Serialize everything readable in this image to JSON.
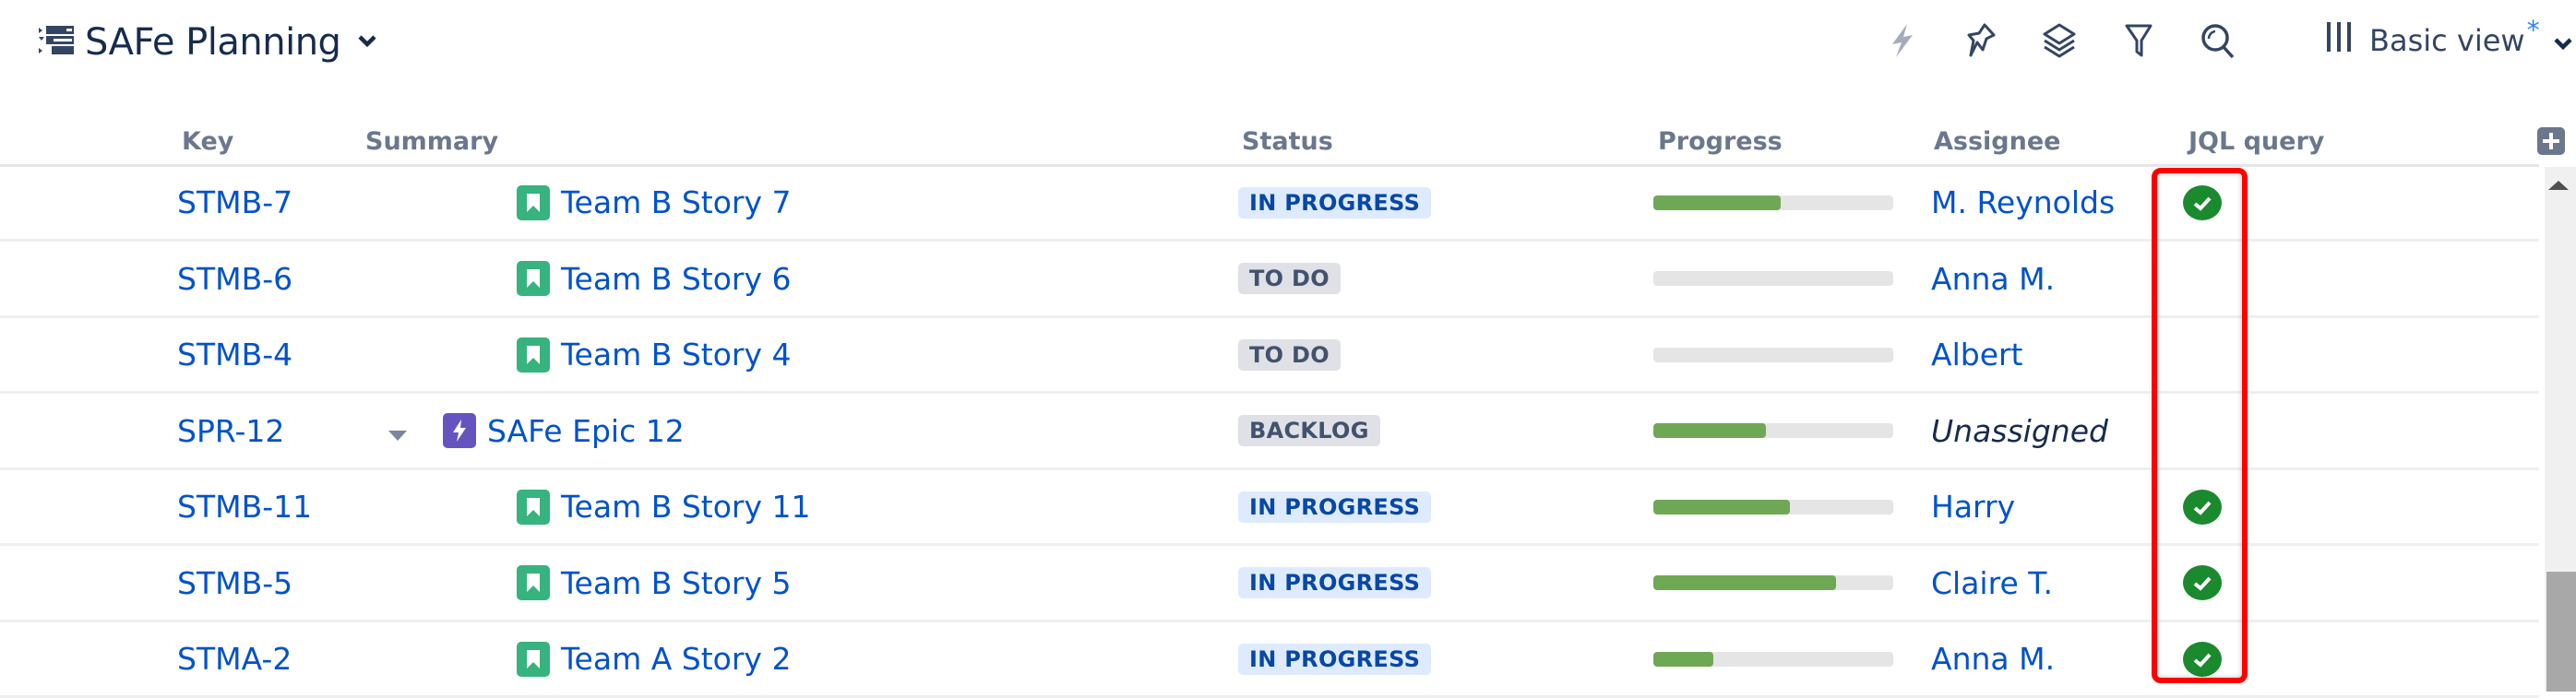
{
  "header": {
    "title": "SAFe Planning",
    "structure_icon": "structure-list-icon",
    "title_menu_icon": "chevron-down-icon",
    "toolbar_icons": [
      "lightning-icon",
      "pin-icon",
      "layers-icon",
      "filter-icon",
      "search-icon"
    ],
    "view": {
      "label": "Basic view",
      "modified_marker": "*",
      "icon": "columns-icon"
    }
  },
  "columns": {
    "key": "Key",
    "summary": "Summary",
    "status": "Status",
    "progress": "Progress",
    "assignee": "Assignee",
    "jql": "JQL query"
  },
  "rows": [
    {
      "key": "STMB-7",
      "summary": "Team B Story 7",
      "type": "story",
      "status": "IN PROGRESS",
      "status_kind": "inprogress",
      "progress_pct": 53,
      "assignee": "M. Reynolds",
      "jql_match": true
    },
    {
      "key": "STMB-6",
      "summary": "Team B Story 6",
      "type": "story",
      "status": "TO DO",
      "status_kind": "todo",
      "progress_pct": 0,
      "assignee": "Anna M.",
      "jql_match": false
    },
    {
      "key": "STMB-4",
      "summary": "Team B Story 4",
      "type": "story",
      "status": "TO DO",
      "status_kind": "todo",
      "progress_pct": 0,
      "assignee": "Albert",
      "jql_match": false
    },
    {
      "key": "SPR-12",
      "summary": "SAFe Epic 12",
      "type": "epic",
      "expanded": true,
      "status": "BACKLOG",
      "status_kind": "backlog",
      "progress_pct": 47,
      "assignee": "Unassigned",
      "unassigned": true,
      "jql_match": false
    },
    {
      "key": "STMB-11",
      "summary": "Team B Story 11",
      "type": "story",
      "status": "IN PROGRESS",
      "status_kind": "inprogress",
      "progress_pct": 57,
      "assignee": "Harry",
      "jql_match": true
    },
    {
      "key": "STMB-5",
      "summary": "Team B Story 5",
      "type": "story",
      "status": "IN PROGRESS",
      "status_kind": "inprogress",
      "progress_pct": 76,
      "assignee": "Claire T.",
      "jql_match": true
    },
    {
      "key": "STMA-2",
      "summary": "Team A Story 2",
      "type": "story",
      "status": "IN PROGRESS",
      "status_kind": "inprogress",
      "progress_pct": 25,
      "assignee": "Anna M.",
      "jql_match": true
    }
  ],
  "colors": {
    "link": "#0052cc",
    "progress_fill": "#6fa855",
    "check": "#1b8a2e",
    "highlight": "#ff0000",
    "story": "#36b37e",
    "epic": "#6554c0"
  }
}
